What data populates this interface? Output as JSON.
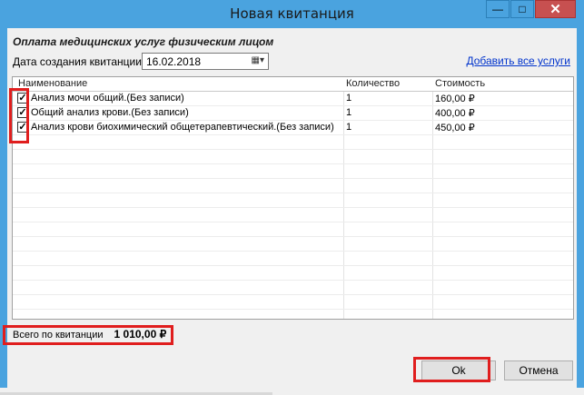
{
  "window": {
    "title": "Новая квитанция"
  },
  "form": {
    "header": "Оплата медицинских услуг физическим лицом",
    "date_label": "Дата создания квитанции",
    "date_value": "16.02.2018",
    "add_link": "Добавить все услуги"
  },
  "grid": {
    "columns": [
      "Наименование",
      "Количество",
      "Стоимость"
    ],
    "rows": [
      {
        "name": "Анализ мочи общий.(Без записи)",
        "qty": "1",
        "price": "160,00 ₽",
        "checked": true
      },
      {
        "name": "Общий  анализ крови.(Без записи)",
        "qty": "1",
        "price": "400,00 ₽",
        "checked": true
      },
      {
        "name": "Анализ крови биохимический общетерапевтический.(Без записи)",
        "qty": "1",
        "price": "450,00 ₽",
        "checked": true
      }
    ]
  },
  "footer": {
    "total_label": "Всего по квитанции",
    "total_value": "1 010,00 ₽",
    "ok_label": "Ok",
    "cancel_label": "Отмена"
  },
  "icons": {
    "minimize": "minimize-icon",
    "maximize": "maximize-icon",
    "close": "close-icon",
    "calendar": "calendar-icon",
    "check": "check-icon"
  },
  "colors": {
    "title_bar": "#4aa3df",
    "highlight": "#e01e1e",
    "link": "#0033cc"
  }
}
